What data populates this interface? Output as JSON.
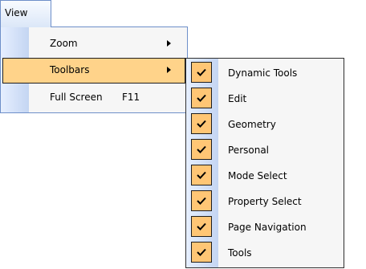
{
  "menubar": {
    "title": "View"
  },
  "dropdown": {
    "items": [
      {
        "label": "Zoom",
        "shortcut": "",
        "has_submenu": true
      },
      {
        "label": "Toolbars",
        "shortcut": "",
        "has_submenu": true,
        "highlighted": true
      },
      {
        "label": "Full Screen",
        "shortcut": "F11",
        "has_submenu": false
      }
    ]
  },
  "submenu": {
    "items": [
      {
        "label": "Dynamic Tools",
        "checked": true
      },
      {
        "label": "Edit",
        "checked": true
      },
      {
        "label": "Geometry",
        "checked": true
      },
      {
        "label": "Personal",
        "checked": true
      },
      {
        "label": "Mode Select",
        "checked": true
      },
      {
        "label": "Property Select",
        "checked": true
      },
      {
        "label": "Page Navigation",
        "checked": true
      },
      {
        "label": "Tools",
        "checked": true
      }
    ]
  },
  "colors": {
    "highlight": "#ffd38a",
    "check_background": "#ffc675",
    "border": "#6e8fc9"
  },
  "icons": {
    "submenu_arrow": "chevron-right-icon",
    "check": "checkmark-icon"
  }
}
